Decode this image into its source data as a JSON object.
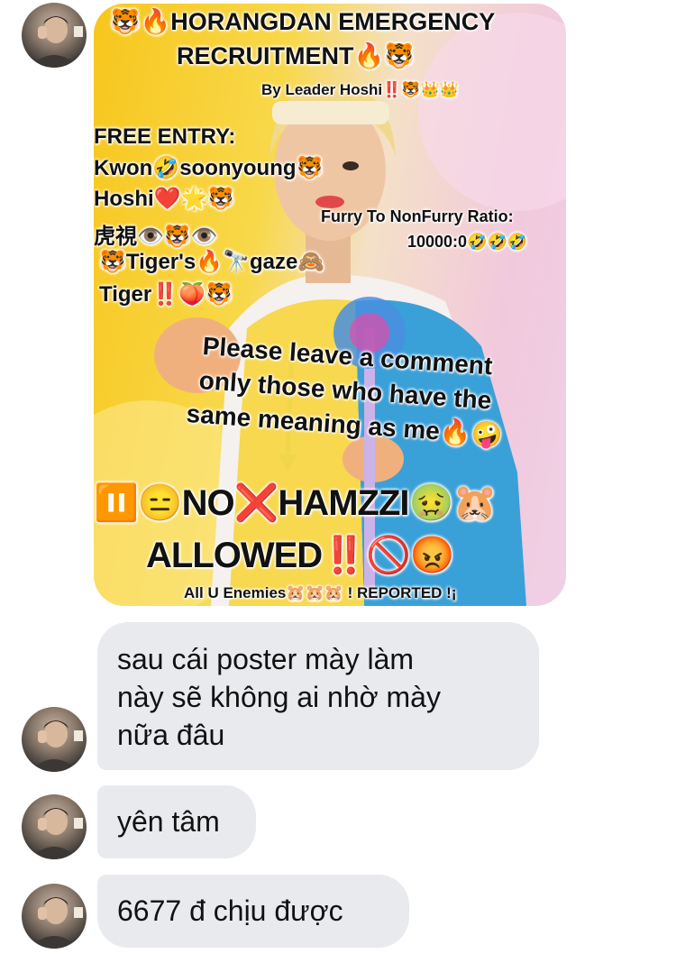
{
  "poster": {
    "title_line1": "🐯🔥HORANGDAN EMERGENCY",
    "title_line2": "RECRUITMENT🔥🐯",
    "byline": "By Leader Hoshi‼️🐯👑👑",
    "free_entry": "FREE ENTRY:",
    "entry1": "Kwon🤣soonyoung🐯",
    "entry2": "Hoshi❤️🌟🐯",
    "entry3": "虎視👁️🐯👁️",
    "entry4": "🐯Tiger's🔥🔭gaze🙈",
    "entry5": "Tiger‼️🍑🐯",
    "ratio_label": "Furry To NonFurry Ratio:",
    "ratio_value": "10000:0🤣🤣🤣",
    "comment_line1": "Please leave a comment",
    "comment_line2": "only those who have the",
    "comment_line3": "same meaning as me🔥🤪",
    "no_hamzzi": "⏸️😑NO❌HAMZZI🤢🐹",
    "allowed": "ALLOWED‼️🚫😡",
    "footer": "All U Enemies🐹🐹🐹 ! REPORTED !¡"
  },
  "messages": [
    {
      "lines": [
        "sau cái poster mày làm",
        "này sẽ không ai nhờ mày",
        "nữa đâu"
      ]
    },
    {
      "lines": [
        "yên tâm"
      ]
    },
    {
      "lines": [
        "6677 đ chịu được"
      ]
    }
  ],
  "colors": {
    "bubble_bg": "#e9eaee",
    "poster_yellow": "#f7c61c",
    "poster_pink": "#f1c9dc",
    "hoodie_blue": "#3aa0d8"
  }
}
